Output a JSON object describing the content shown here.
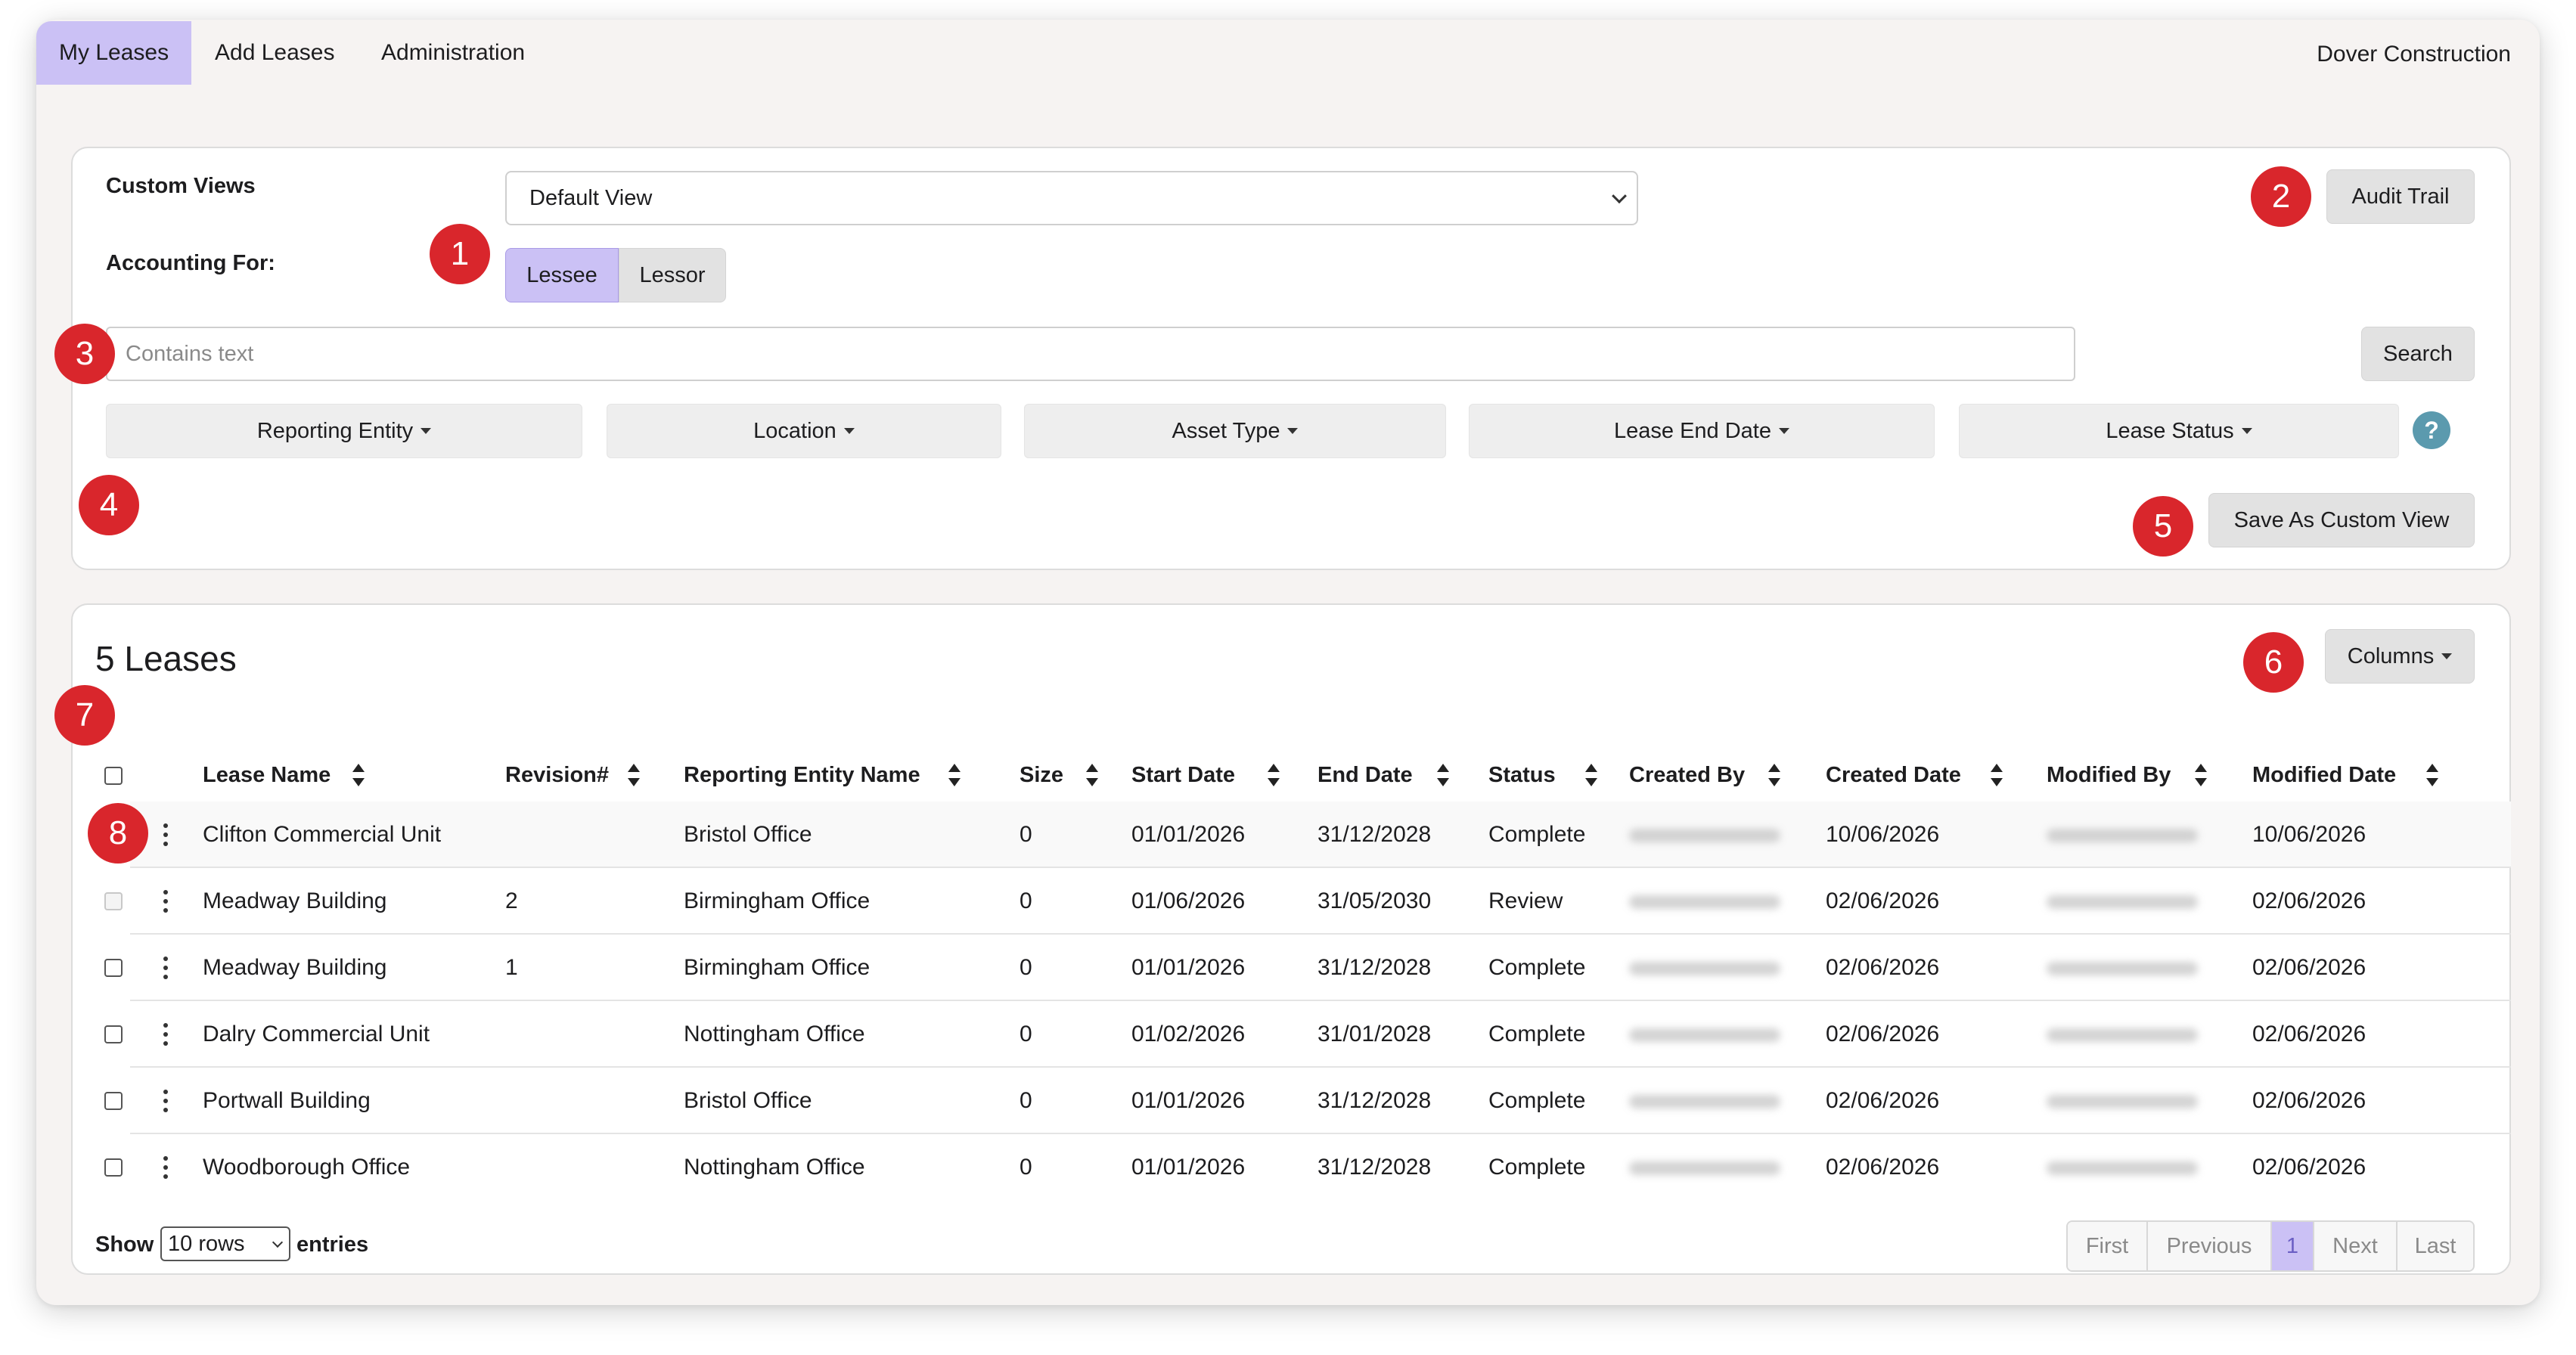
{
  "nav": {
    "tabs": [
      {
        "label": "My Leases",
        "active": true
      },
      {
        "label": "Add Leases",
        "active": false
      },
      {
        "label": "Administration",
        "active": false
      }
    ],
    "company": "Dover Construction"
  },
  "filters": {
    "custom_views_label": "Custom Views",
    "custom_view_selected": "Default View",
    "accounting_for_label": "Accounting For:",
    "accounting_options": [
      "Lessee",
      "Lessor"
    ],
    "accounting_selected": "Lessee",
    "audit_trail_label": "Audit Trail",
    "search_placeholder": "Contains text",
    "search_value": "",
    "search_button": "Search",
    "dropdowns": [
      "Reporting Entity",
      "Location",
      "Asset Type",
      "Lease End Date",
      "Lease Status"
    ],
    "help_label": "?",
    "save_view_label": "Save As Custom View"
  },
  "markers": [
    "1",
    "2",
    "3",
    "4",
    "5",
    "6",
    "7",
    "8"
  ],
  "table": {
    "title": "5 Leases",
    "columns_button": "Columns",
    "headers": [
      "Lease Name",
      "Revision#",
      "Reporting Entity Name",
      "Size",
      "Start Date",
      "End Date",
      "Status",
      "Created By",
      "Created Date",
      "Modified By",
      "Modified Date"
    ],
    "rows": [
      {
        "name": "Clifton Commercial Unit",
        "revision": "",
        "entity": "Bristol Office",
        "size": "0",
        "start": "01/01/2026",
        "end": "31/12/2028",
        "status": "Complete",
        "created": "10/06/2026",
        "modified": "10/06/2026"
      },
      {
        "name": "Meadway Building",
        "revision": "2",
        "entity": "Birmingham Office",
        "size": "0",
        "start": "01/06/2026",
        "end": "31/05/2030",
        "status": "Review",
        "created": "02/06/2026",
        "modified": "02/06/2026"
      },
      {
        "name": "Meadway Building",
        "revision": "1",
        "entity": "Birmingham Office",
        "size": "0",
        "start": "01/01/2026",
        "end": "31/12/2028",
        "status": "Complete",
        "created": "02/06/2026",
        "modified": "02/06/2026"
      },
      {
        "name": "Dalry Commercial Unit",
        "revision": "",
        "entity": "Nottingham Office",
        "size": "0",
        "start": "01/02/2026",
        "end": "31/01/2028",
        "status": "Complete",
        "created": "02/06/2026",
        "modified": "02/06/2026"
      },
      {
        "name": "Portwall Building",
        "revision": "",
        "entity": "Bristol Office",
        "size": "0",
        "start": "01/01/2026",
        "end": "31/12/2028",
        "status": "Complete",
        "created": "02/06/2026",
        "modified": "02/06/2026"
      },
      {
        "name": "Woodborough Office",
        "revision": "",
        "entity": "Nottingham Office",
        "size": "0",
        "start": "01/01/2026",
        "end": "31/12/2028",
        "status": "Complete",
        "created": "02/06/2026",
        "modified": "02/06/2026"
      }
    ],
    "show_label": "Show",
    "rows_selected": "10 rows",
    "entries_label": "entries",
    "pagination": [
      "First",
      "Previous",
      "1",
      "Next",
      "Last"
    ],
    "current_page": "1"
  },
  "colors": {
    "accent": "#cbc1f5",
    "marker": "#d9262c",
    "help": "#5b9aae"
  }
}
